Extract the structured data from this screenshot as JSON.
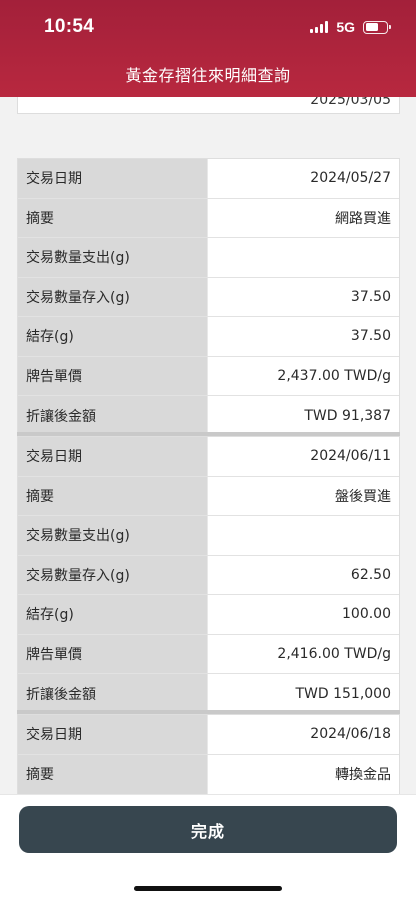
{
  "status_bar": {
    "time": "10:54",
    "network": "5G",
    "battery_level": 0.62
  },
  "header": {
    "title": "黃金存摺往來明細查詢"
  },
  "previous_record": {
    "visible_date": "2025/03/05"
  },
  "records": [
    {
      "rows": [
        {
          "label": "交易日期",
          "value": "2024/05/27"
        },
        {
          "label": "摘要",
          "value": "網路買進"
        },
        {
          "label": "交易數量支出(g)",
          "value": ""
        },
        {
          "label": "交易數量存入(g)",
          "value": "37.50"
        },
        {
          "label": "結存(g)",
          "value": "37.50"
        },
        {
          "label": "牌告單價",
          "value": "2,437.00 TWD/g"
        },
        {
          "label": "折讓後金額",
          "value": "TWD 91,387"
        }
      ]
    },
    {
      "rows": [
        {
          "label": "交易日期",
          "value": "2024/06/11"
        },
        {
          "label": "摘要",
          "value": "盤後買進"
        },
        {
          "label": "交易數量支出(g)",
          "value": ""
        },
        {
          "label": "交易數量存入(g)",
          "value": "62.50"
        },
        {
          "label": "結存(g)",
          "value": "100.00"
        },
        {
          "label": "牌告單價",
          "value": "2,416.00 TWD/g"
        },
        {
          "label": "折讓後金額",
          "value": "TWD 151,000"
        }
      ]
    },
    {
      "rows": [
        {
          "label": "交易日期",
          "value": "2024/06/18"
        },
        {
          "label": "摘要",
          "value": "轉換金品"
        }
      ]
    }
  ],
  "footer": {
    "done_label": "完成"
  }
}
